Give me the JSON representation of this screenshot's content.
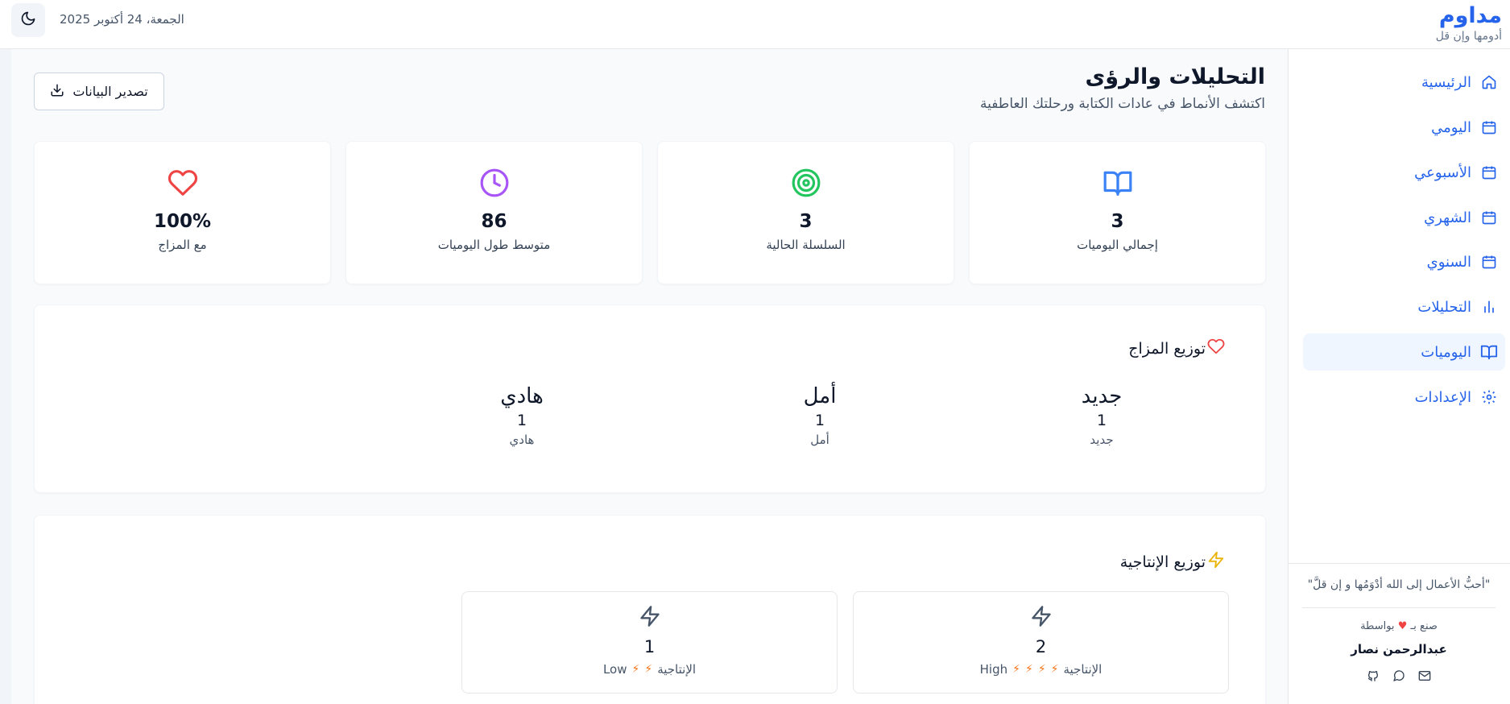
{
  "header": {
    "brand_title": "مداوم",
    "brand_tagline": "أدومها وإن قل",
    "date": "الجمعة، 24 أكتوبر 2025",
    "theme_toggle_icon": "moon-icon"
  },
  "sidebar": {
    "items": [
      {
        "label": "الرئيسية",
        "icon": "home-icon",
        "active": false
      },
      {
        "label": "اليومي",
        "icon": "calendar-icon",
        "active": false
      },
      {
        "label": "الأسبوعي",
        "icon": "calendar-icon",
        "active": false
      },
      {
        "label": "الشهري",
        "icon": "calendar-icon",
        "active": false
      },
      {
        "label": "السنوي",
        "icon": "calendar-icon",
        "active": false
      },
      {
        "label": "التحليلات",
        "icon": "bar-chart-icon",
        "active": false
      },
      {
        "label": "اليوميات",
        "icon": "book-icon",
        "active": true
      },
      {
        "label": "الإعدادات",
        "icon": "gear-icon",
        "active": false
      }
    ],
    "quote": "\"أحبُّ الأعمال إلى الله أدْوَمُها و إن قلَّ\"",
    "made_with_prefix": "صنع بـ",
    "made_with_suffix": "بواسطة",
    "author": "عبدالرحمن نصار",
    "social_icons": [
      "github-icon",
      "message-icon",
      "mail-icon"
    ]
  },
  "main": {
    "title": "التحليلات والرؤى",
    "subtitle": "اكتشف الأنماط في عادات الكتابة ورحلتك العاطفية",
    "export_label": "تصدير البيانات",
    "stats": [
      {
        "value": "3",
        "label": "إجمالي اليوميات",
        "icon": "book-open-icon",
        "color": "#3b82f6"
      },
      {
        "value": "3",
        "label": "السلسلة الحالية",
        "icon": "target-icon",
        "color": "#22c55e"
      },
      {
        "value": "86",
        "label": "متوسط طول اليوميات",
        "icon": "clock-icon",
        "color": "#a855f7"
      },
      {
        "value": "100%",
        "label": "مع المزاج",
        "icon": "heart-icon",
        "color": "#ef4444"
      }
    ],
    "mood": {
      "title": "توزيع المزاج",
      "items": [
        {
          "word": "جديد",
          "count": "1",
          "label": "جديد"
        },
        {
          "word": "أمل",
          "count": "1",
          "label": "أمل"
        },
        {
          "word": "هادي",
          "count": "1",
          "label": "هادي"
        }
      ]
    },
    "productivity": {
      "title": "توزيع الإنتاجية",
      "items": [
        {
          "count": "2",
          "level": "High",
          "label": "الإنتاجية"
        },
        {
          "count": "1",
          "level": "Low",
          "label": "الإنتاجية"
        }
      ]
    }
  },
  "colors": {
    "accent": "#2563eb",
    "active_bg": "#eff6ff",
    "heart": "#ef4444",
    "bolt_orange": "#f97316",
    "bolt_yellow": "#eab308"
  }
}
